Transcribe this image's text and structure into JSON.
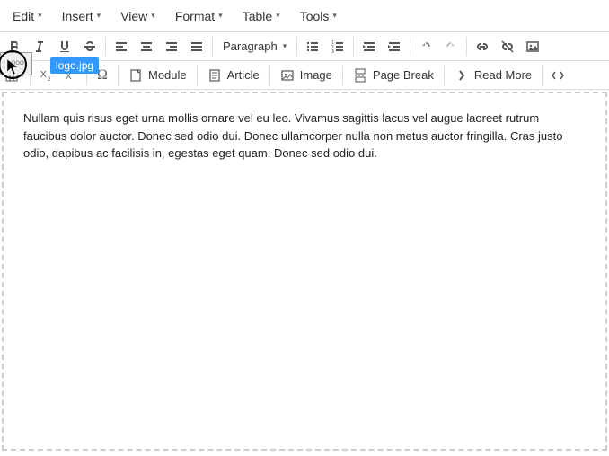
{
  "menubar": {
    "edit": "Edit",
    "insert": "Insert",
    "view": "View",
    "format": "Format",
    "table": "Table",
    "tools": "Tools"
  },
  "toolbar1": {
    "paragraph": "Paragraph"
  },
  "toolbar2": {
    "module": "Module",
    "article": "Article",
    "image": "Image",
    "page_break": "Page Break",
    "read_more": "Read More"
  },
  "tooltip": "logo.jpg",
  "content": "Nullam quis risus eget urna mollis ornare vel eu leo. Vivamus sagittis lacus vel augue laoreet rutrum faucibus dolor auctor. Donec sed odio dui. Donec ullamcorper nulla non metus auctor fringilla. Cras justo odio, dapibus ac facilisis in, egestas eget quam. Donec sed odio dui."
}
